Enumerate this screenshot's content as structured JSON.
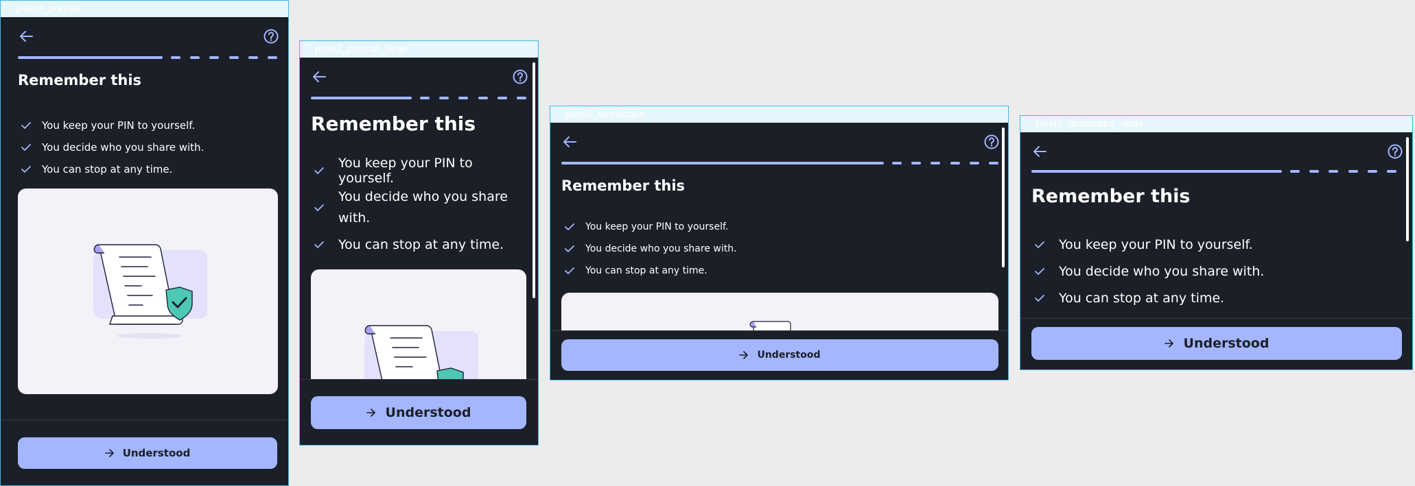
{
  "frames": {
    "portrait": {
      "label": "pixel2_portrait"
    },
    "portrait_large": {
      "label": "pixel2_portrait_large"
    },
    "landscape": {
      "label": "pixel2_landscape"
    },
    "landscape_large": {
      "label": "pixel2_landscape_large"
    }
  },
  "screen": {
    "title": "Remember this",
    "items": [
      "You keep your PIN to yourself.",
      "You decide who you share with.",
      "You can stop at any time."
    ],
    "cta_label": "Understood",
    "progress": {
      "completed_fraction": 0.55,
      "remaining_dashes": 6
    }
  },
  "icons": {
    "back": "arrow-left-icon",
    "help": "help-circle-icon",
    "check": "check-icon",
    "cta": "arrow-right-icon"
  },
  "colors": {
    "background": "#1b1f27",
    "accent": "#a4b6ff",
    "text": "#ffffff",
    "frame_outline": "#3eb8e6"
  }
}
